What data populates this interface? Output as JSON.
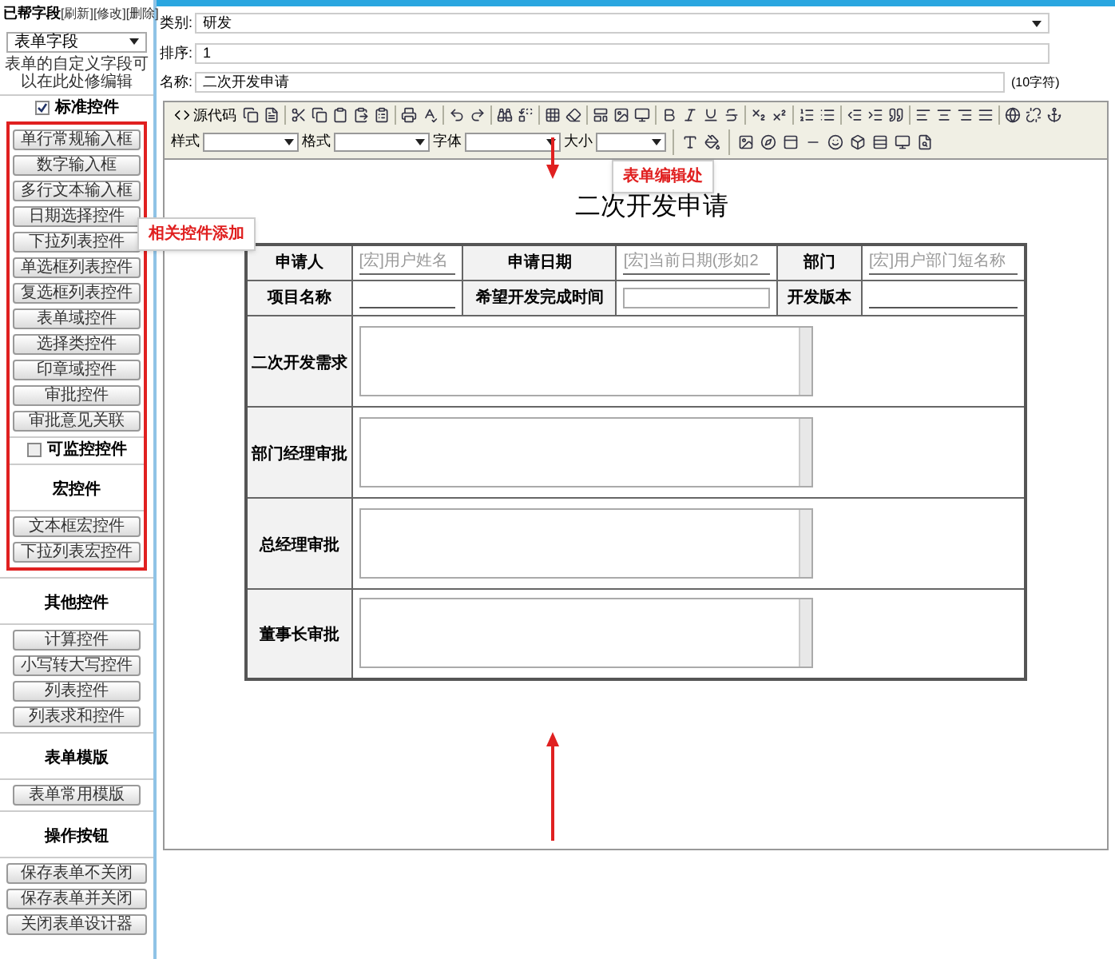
{
  "sidebar": {
    "title": "已帮字段",
    "links": [
      "[刷新]",
      "[修改]",
      "[删除]"
    ],
    "field_select": {
      "value": "表单字段",
      "hint": "表单的自定义字段可以在此处修编辑"
    },
    "standard_toggle": {
      "label": "标准控件",
      "checked": true
    },
    "highlighted_groups": [
      {
        "kind": "buttons",
        "items": [
          "单行常规输入框",
          "数字输入框",
          "多行文本输入框",
          "日期选择控件",
          "下拉列表控件",
          "单选框列表控件",
          "复选框列表控件",
          "表单域控件",
          "选择类控件",
          "印章域控件",
          "审批控件",
          "审批意见关联"
        ]
      },
      {
        "kind": "checkbox",
        "label": "可监控控件",
        "checked": false
      },
      {
        "kind": "heading",
        "label": "宏控件"
      },
      {
        "kind": "buttons",
        "items": [
          "文本框宏控件",
          "下拉列表宏控件"
        ]
      }
    ],
    "other_groups": [
      {
        "kind": "heading",
        "label": "其他控件"
      },
      {
        "kind": "buttons",
        "items": [
          "计算控件",
          "小写转大写控件",
          "列表控件",
          "列表求和控件"
        ]
      },
      {
        "kind": "heading",
        "label": "表单模版"
      },
      {
        "kind": "buttons",
        "items": [
          "表单常用模版"
        ]
      },
      {
        "kind": "heading",
        "label": "操作按钮"
      },
      {
        "kind": "wide_buttons",
        "items": [
          "保存表单不关闭",
          "保存表单并关闭",
          "关闭表单设计器"
        ]
      }
    ]
  },
  "fields": [
    {
      "label": "类别:",
      "value": "研发",
      "kind": "select"
    },
    {
      "label": "排序:",
      "value": "1",
      "kind": "input"
    },
    {
      "label": "名称:",
      "value": "二次开发申请",
      "kind": "input",
      "note": "(10字符)"
    }
  ],
  "toolbar": {
    "source_label": "源代码",
    "dropdowns": [
      "样式",
      "格式",
      "字体",
      "大小"
    ]
  },
  "form": {
    "title": "二次开发申请",
    "top_rows": [
      [
        {
          "kind": "label",
          "text": "申请人"
        },
        {
          "kind": "macro",
          "text": "[宏]用户姓名"
        },
        {
          "kind": "label",
          "text": "申请日期"
        },
        {
          "kind": "macro",
          "text": "[宏]当前日期(形如2"
        },
        {
          "kind": "label",
          "text": "部门"
        },
        {
          "kind": "macro",
          "text": "[宏]用户部门短名称"
        }
      ],
      [
        {
          "kind": "label",
          "text": "项目名称"
        },
        {
          "kind": "line"
        },
        {
          "kind": "label",
          "text": "希望开发完成时间"
        },
        {
          "kind": "box"
        },
        {
          "kind": "label",
          "text": "开发版本"
        },
        {
          "kind": "line"
        }
      ]
    ],
    "text_rows": [
      "二次开发需求",
      "部门经理审批",
      "总经理审批",
      "董事长审批"
    ]
  },
  "annotations": [
    {
      "text": "相关控件添加"
    },
    {
      "text": "表单编辑处"
    }
  ]
}
